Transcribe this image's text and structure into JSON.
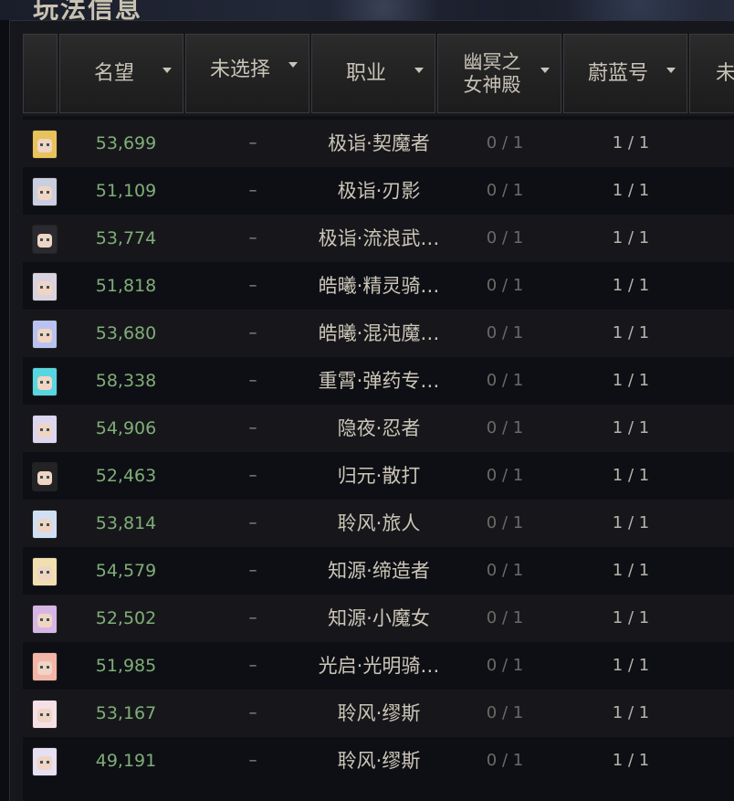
{
  "page": {
    "title": "玩法信息"
  },
  "table": {
    "columns": [
      {
        "label": "名望"
      },
      {
        "label": "未选择"
      },
      {
        "label": "职业"
      },
      {
        "label": "幽冥之女神殿"
      },
      {
        "label": "蔚蓝号"
      },
      {
        "label": "未"
      }
    ],
    "rows": [
      {
        "fame": "53,699",
        "sel": "–",
        "job": "极诣·契魔者",
        "ygs": "0 / 1",
        "wl": "1 / 1",
        "hair": "#e8c25a"
      },
      {
        "fame": "51,109",
        "sel": "–",
        "job": "极诣·刃影",
        "ygs": "0 / 1",
        "wl": "1 / 1",
        "hair": "#c9cfe0"
      },
      {
        "fame": "53,774",
        "sel": "–",
        "job": "极诣·流浪武…",
        "ygs": "0 / 1",
        "wl": "1 / 1",
        "hair": "#2a2a30"
      },
      {
        "fame": "51,818",
        "sel": "–",
        "job": "皓曦·精灵骑…",
        "ygs": "0 / 1",
        "wl": "1 / 1",
        "hair": "#d9d3e0"
      },
      {
        "fame": "53,680",
        "sel": "–",
        "job": "皓曦·混沌魔…",
        "ygs": "0 / 1",
        "wl": "1 / 1",
        "hair": "#b9c3f0"
      },
      {
        "fame": "58,338",
        "sel": "–",
        "job": "重霄·弹药专…",
        "ygs": "0 / 1",
        "wl": "1 / 1",
        "hair": "#58d6e0"
      },
      {
        "fame": "54,906",
        "sel": "–",
        "job": "隐夜·忍者",
        "ygs": "0 / 1",
        "wl": "1 / 1",
        "hair": "#dcd6ef"
      },
      {
        "fame": "52,463",
        "sel": "–",
        "job": "归元·散打",
        "ygs": "0 / 1",
        "wl": "1 / 1",
        "hair": "#232326"
      },
      {
        "fame": "53,814",
        "sel": "–",
        "job": "聆风·旅人",
        "ygs": "0 / 1",
        "wl": "1 / 1",
        "hair": "#cfe0f5"
      },
      {
        "fame": "54,579",
        "sel": "–",
        "job": "知源·缔造者",
        "ygs": "0 / 1",
        "wl": "1 / 1",
        "hair": "#f2dfb0"
      },
      {
        "fame": "52,502",
        "sel": "–",
        "job": "知源·小魔女",
        "ygs": "0 / 1",
        "wl": "1 / 1",
        "hair": "#d7b6e6"
      },
      {
        "fame": "51,985",
        "sel": "–",
        "job": "光启·光明骑…",
        "ygs": "0 / 1",
        "wl": "1 / 1",
        "hair": "#f3b6a8"
      },
      {
        "fame": "53,167",
        "sel": "–",
        "job": "聆风·缪斯",
        "ygs": "0 / 1",
        "wl": "1 / 1",
        "hair": "#f5e0e6"
      },
      {
        "fame": "49,191",
        "sel": "–",
        "job": "聆风·缪斯",
        "ygs": "0 / 1",
        "wl": "1 / 1",
        "hair": "#e6e0f2"
      }
    ]
  }
}
